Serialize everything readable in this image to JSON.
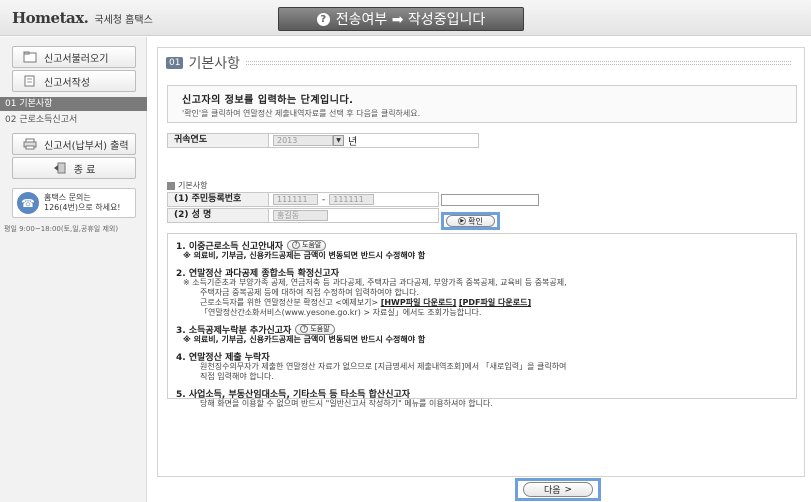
{
  "header": {
    "logo_mark": "Hometax.",
    "logo_text": "국세청 홈택스",
    "status": "전송여부 ➡ 작성중입니다"
  },
  "sidebar": {
    "load_btn": "신고서불러오기",
    "write_btn": "신고서작성",
    "steps": [
      "01 기본사항",
      "02 근로소득신고서"
    ],
    "print_btn": "신고서(납부서) 출력",
    "exit_btn": "종 료",
    "help_line1": "홈택스 문의는",
    "help_line2": "126(4번)으로 하세요!",
    "help_hours": "평일 9:00~18:00(토,일,공휴일 제외)"
  },
  "section": {
    "num": "01",
    "title": "기본사항"
  },
  "intro": {
    "main": "신고자의 정보를 입력하는 단계입니다.",
    "sub": "'확인'을 클릭하여 연말정산 제출내역자료를 선택 후 다음을 클릭하세요."
  },
  "form": {
    "year_label": "귀속연도",
    "year_value": "2013",
    "year_unit": "년",
    "basic_label": "기본사항",
    "id_label": "(1) 주민등록번호",
    "id_front": "111111",
    "id_dash": "-",
    "id_back": "111111",
    "name_label": "(2) 성        명",
    "name_value": "홍길동",
    "confirm_btn": "확인"
  },
  "notice": {
    "item1_title": "1. 이중근로소득 신고안내자",
    "item1_btn": "도움말",
    "item1_line": "※ 의료비, 기부금, 신용카드공제는 금액이 변동되면 반드시 수정해야 함",
    "item2_title": "2. 연말정산 과다공제 종합소득 확정신고자",
    "item2_line1": "※ 소득기준초과 부양가족 공제, 연금저축 등 과다공제, 주택자금 과다공제, 부양가족 중복공제, 교육비 등 중복공제,",
    "item2_line2": "주택자금 중복공제 등에 대하여 직접 수정하여 입력하여야 합니다.",
    "item2_line3a": "근로소득자를 위한 연말정산분 확정신고 <예제보기>",
    "item2_link1": "[HWP파일 다운로드]",
    "item2_link2": "[PDF파일 다운로드]",
    "item2_line4": "「연말정산간소화서비스(www.yesone.go.kr) > 자료실」에서도 조회가능합니다.",
    "item3_title": "3. 소득공제누락분 추가신고자",
    "item3_btn": "도움말",
    "item3_line": "※ 의료비, 기부금, 신용카드공제는 금액이 변동되면 반드시 수정해야 함",
    "item4_title": "4. 연말정산 제출 누락자",
    "item4_line1": "원천징수의무자가 제출한 연말정산 자료가 없으므로 [지급명세서 제출내역조회]에서 「새로입력」을 클릭하여",
    "item4_line2": "직접 입력해야 합니다.",
    "item5_title": "5. 사업소득, 부동산임대소득, 기타소득 등 타소득 합산신고자",
    "item5_line": "당해 화면을 이용할 수 없으며 반드시 \"일반신고서 작성하기\" 메뉴를 이용하셔야 합니다."
  },
  "footer": {
    "next_btn": "다음"
  }
}
